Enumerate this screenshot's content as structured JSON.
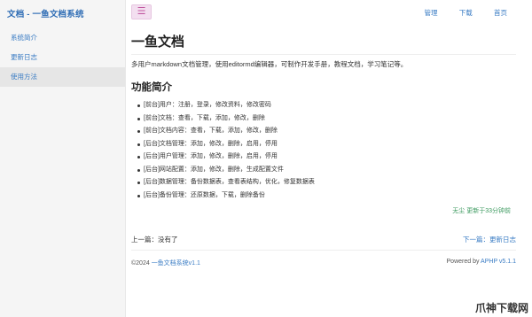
{
  "brand": "文档 - 一鱼文档系统",
  "sidebar": {
    "items": [
      {
        "label": "系统简介"
      },
      {
        "label": "更新日志"
      },
      {
        "label": "使用方法"
      }
    ]
  },
  "topbar": {
    "menu_icon": "☰",
    "nav": [
      "管理",
      "下载",
      "首页"
    ]
  },
  "article": {
    "title": "一鱼文档",
    "intro": "多用户markdown文档管理，使用editormd编辑器，可制作开发手册，教程文档，学习笔记等。",
    "section_title": "功能简介",
    "features": [
      "[前台]用户：注册，登录，修改资料，修改密码",
      "[前台]文档：查看，下载，添加，修改，删除",
      "[前台]文档内容：查看，下载，添加，修改，删除",
      "[后台]文档管理：添加，修改，删除，启用，停用",
      "[后台]用户管理：添加，修改，删除，启用，停用",
      "[后台]网站配置：添加，修改，删除，生成配置文件",
      "[后台]数据管理：备份数据表，查看表结构，优化，修复数据表",
      "[后台]备份管理：还原数据，下载，删除备份"
    ],
    "updated": "无尘 更新于33分钟前"
  },
  "pager": {
    "prev": "上一篇：没有了",
    "next": "下一篇：更新日志"
  },
  "footer": {
    "copyright": "©2024",
    "site_link": "一鱼文档系统v1.1",
    "powered_by": "Powered by",
    "powered_link": "APHP v5.1.1"
  },
  "watermark": "爪神下载网"
}
